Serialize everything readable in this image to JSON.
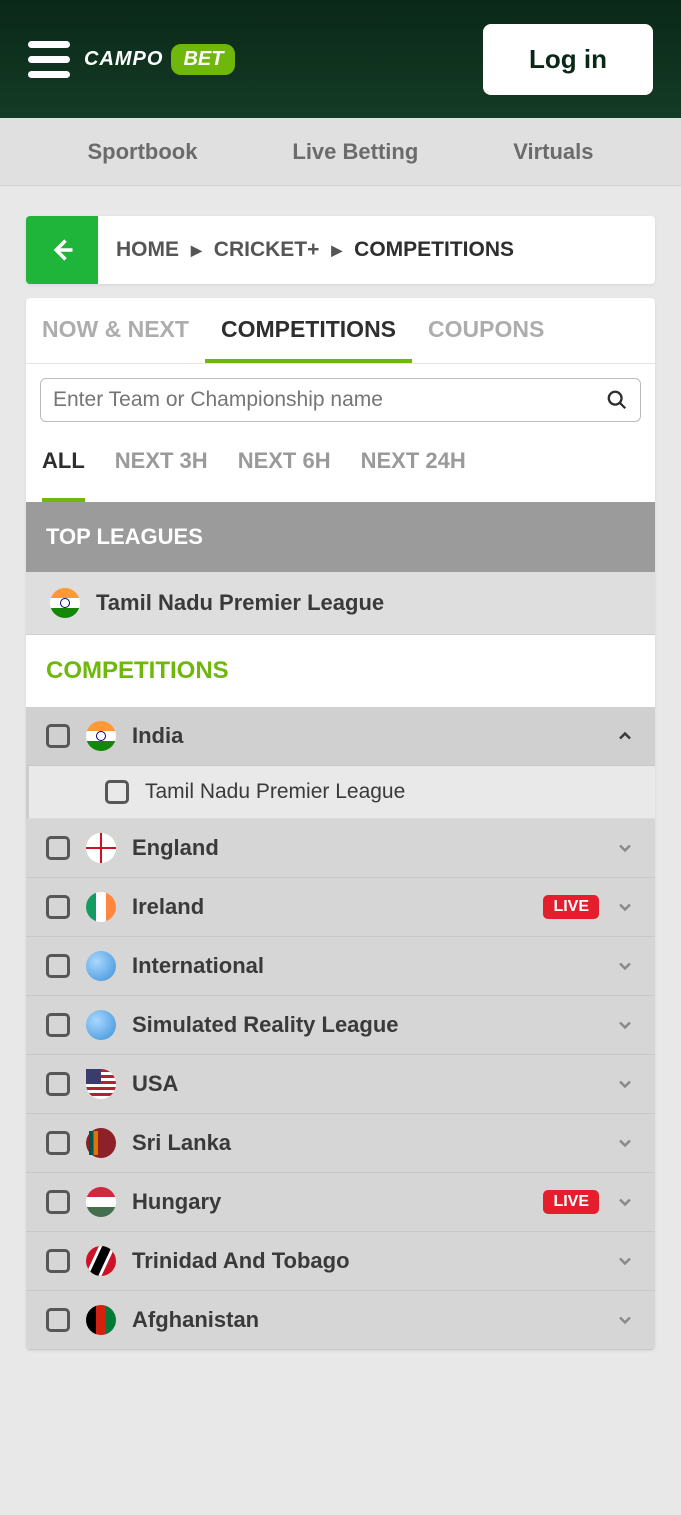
{
  "header": {
    "logo_text": "CAMPO",
    "logo_badge": "BET",
    "login_label": "Log in"
  },
  "nav2": {
    "sportbook": "Sportbook",
    "live_betting": "Live Betting",
    "virtuals": "Virtuals"
  },
  "breadcrumb": {
    "home": "HOME",
    "sport": "CRICKET+",
    "current": "COMPETITIONS"
  },
  "tabs": {
    "now_next": "NOW & NEXT",
    "competitions": "COMPETITIONS",
    "coupons": "COUPONS"
  },
  "search": {
    "placeholder": "Enter Team or Championship name"
  },
  "time_tabs": {
    "all": "ALL",
    "next3h": "NEXT 3H",
    "next6h": "NEXT 6H",
    "next24h": "NEXT 24H"
  },
  "sections": {
    "top_leagues": "TOP LEAGUES",
    "competitions_title": "COMPETITIONS"
  },
  "top_league": {
    "label": "Tamil Nadu Premier League",
    "flag": "india"
  },
  "live_label": "LIVE",
  "competitions": [
    {
      "name": "India",
      "flag": "india",
      "expanded": true,
      "live": false,
      "children": [
        {
          "name": "Tamil Nadu Premier League"
        }
      ]
    },
    {
      "name": "England",
      "flag": "england",
      "expanded": false,
      "live": false
    },
    {
      "name": "Ireland",
      "flag": "ireland",
      "expanded": false,
      "live": true
    },
    {
      "name": "International",
      "flag": "globe",
      "expanded": false,
      "live": false
    },
    {
      "name": "Simulated Reality League",
      "flag": "globe",
      "expanded": false,
      "live": false
    },
    {
      "name": "USA",
      "flag": "usa",
      "expanded": false,
      "live": false
    },
    {
      "name": "Sri Lanka",
      "flag": "srilanka",
      "expanded": false,
      "live": false
    },
    {
      "name": "Hungary",
      "flag": "hungary",
      "expanded": false,
      "live": true
    },
    {
      "name": "Trinidad And Tobago",
      "flag": "trinidad",
      "expanded": false,
      "live": false
    },
    {
      "name": "Afghanistan",
      "flag": "afghanistan",
      "expanded": false,
      "live": false
    }
  ]
}
